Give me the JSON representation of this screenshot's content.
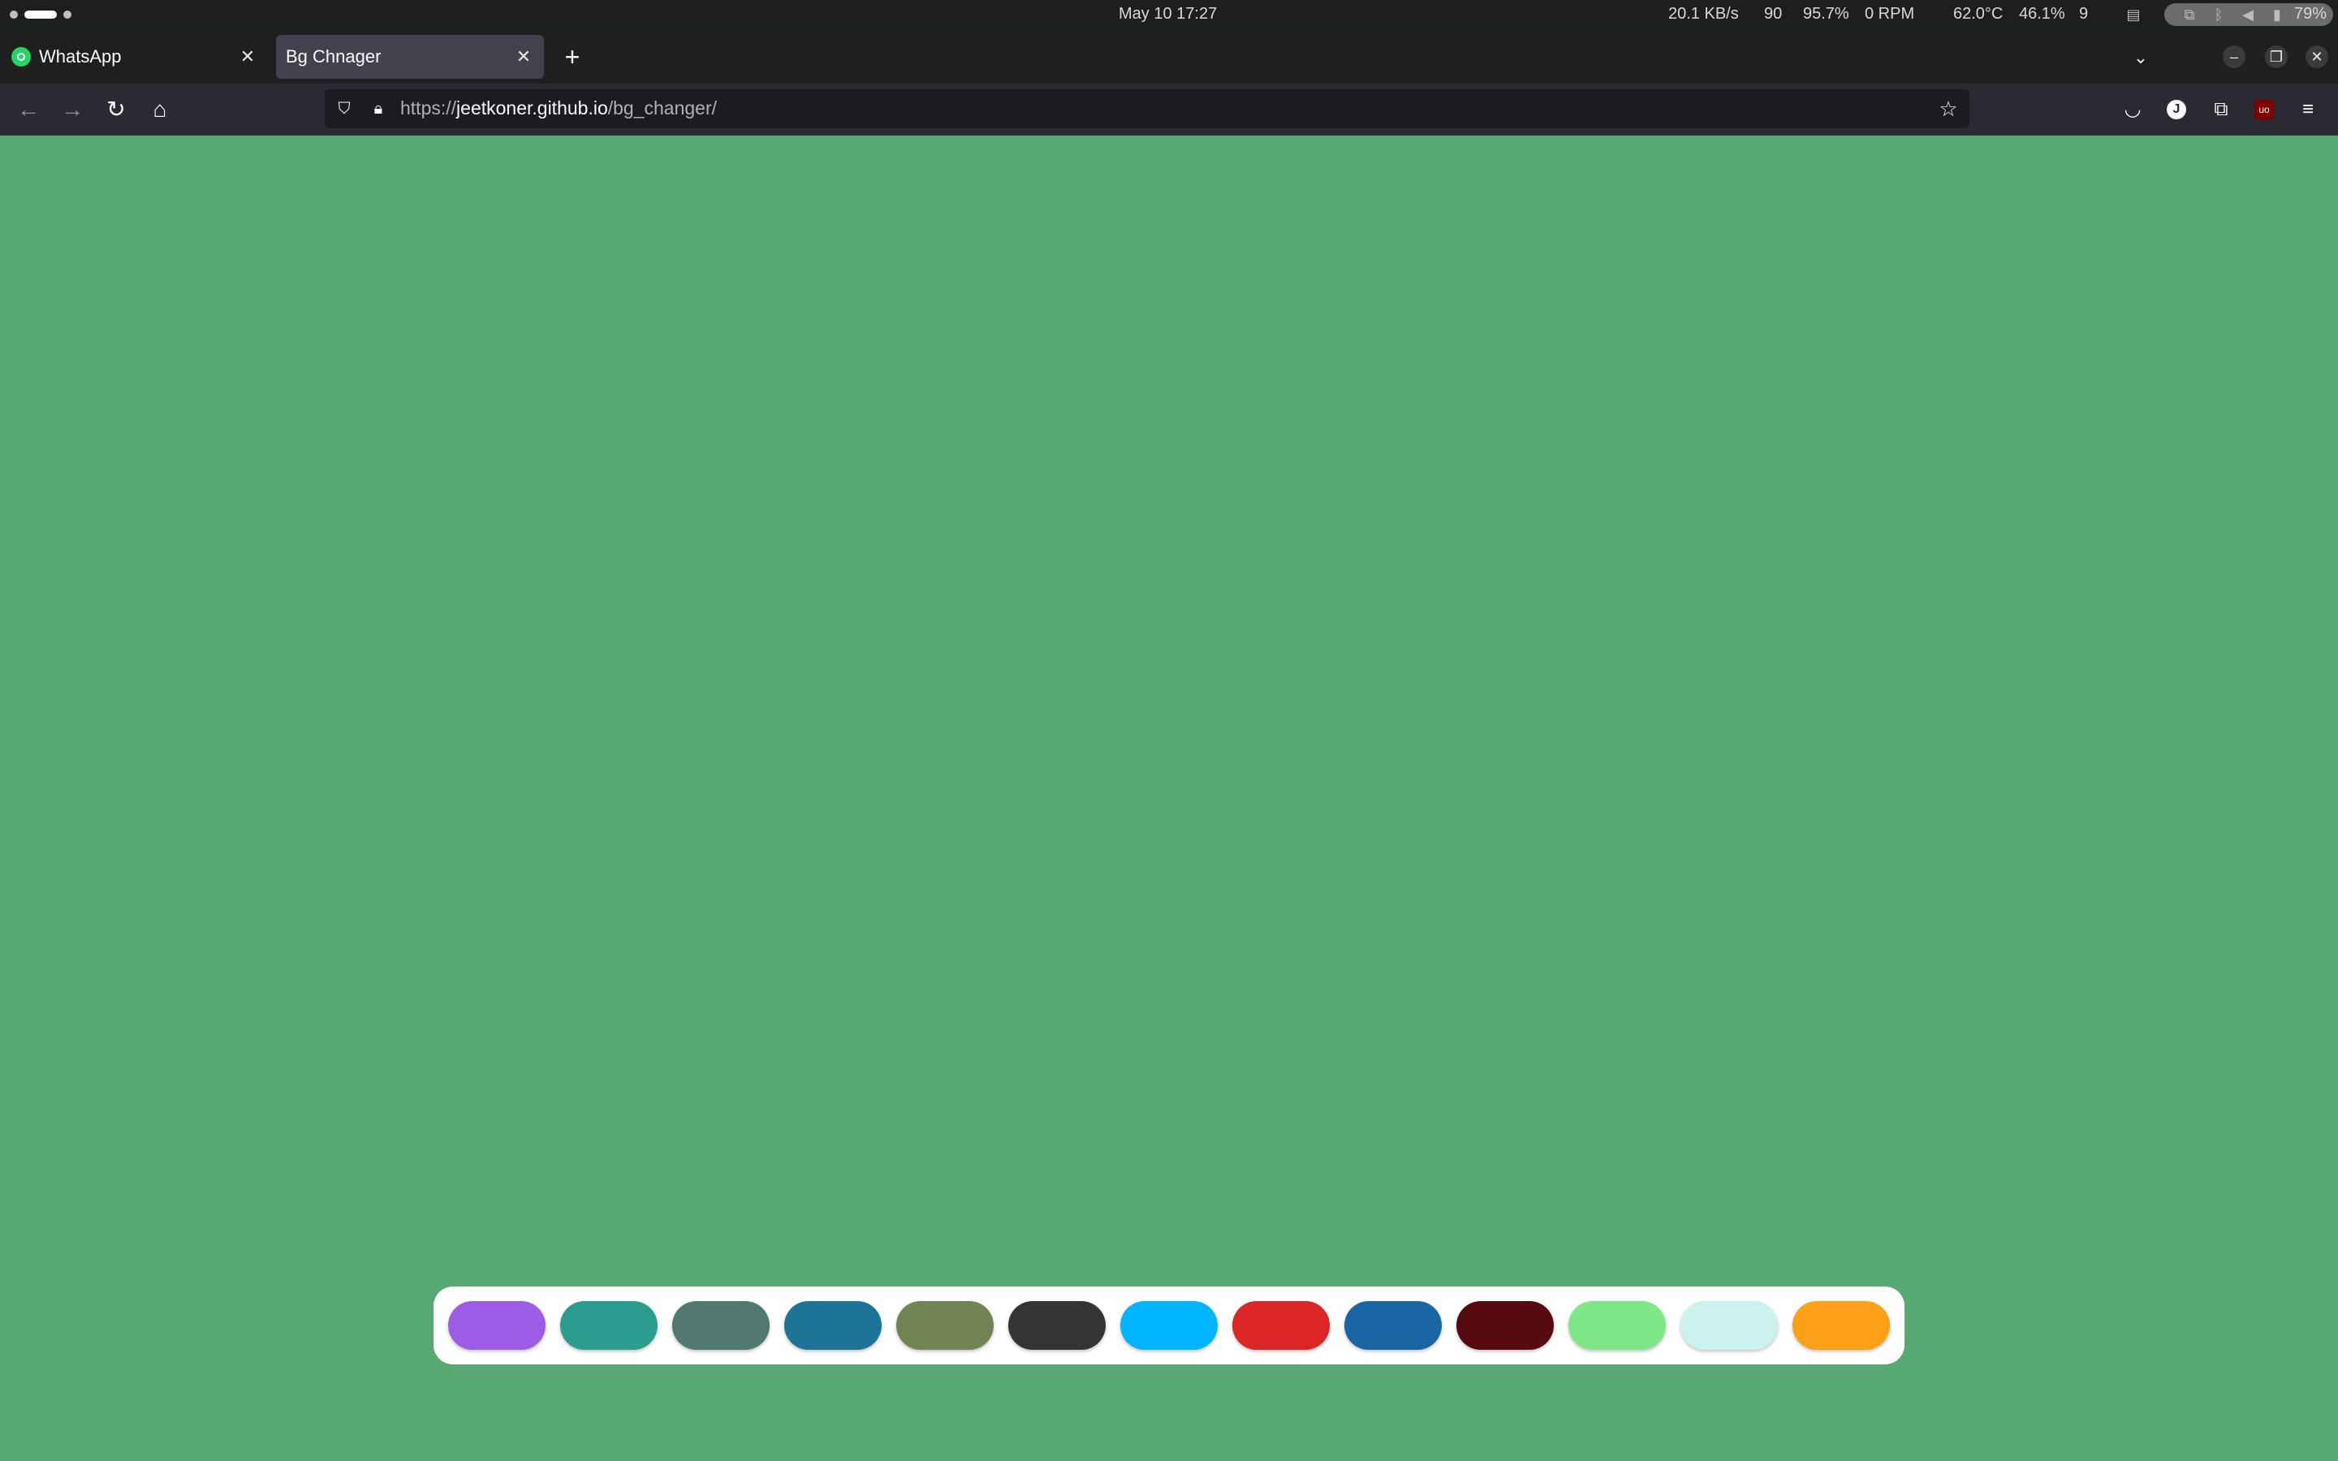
{
  "system": {
    "clock": "May 10  17:27",
    "net_speed": "20.1 KB/s",
    "stat_a": "90",
    "cpu": "95.7%",
    "fan": "0 RPM",
    "temp": "62.0°C",
    "mem": "46.1%",
    "stat_b": "9",
    "battery": "79%"
  },
  "tabs": [
    {
      "label": "WhatsApp",
      "active": false
    },
    {
      "label": "Bg Chnager",
      "active": true
    }
  ],
  "new_tab_label": "+",
  "url": {
    "scheme": "https://",
    "host": "jeetkoner.github.io",
    "path": "/bg_changer/"
  },
  "page": {
    "background": "#58a872"
  },
  "palette": [
    {
      "name": "purple",
      "color": "#9d5ce6"
    },
    {
      "name": "teal",
      "color": "#2a9d8f"
    },
    {
      "name": "slate-green",
      "color": "#52796f"
    },
    {
      "name": "steel-blue",
      "color": "#1d7497"
    },
    {
      "name": "olive",
      "color": "#708454"
    },
    {
      "name": "charcoal",
      "color": "#343434"
    },
    {
      "name": "sky-blue",
      "color": "#00b4fd"
    },
    {
      "name": "red",
      "color": "#dc2626"
    },
    {
      "name": "blue",
      "color": "#1a66a5"
    },
    {
      "name": "maroon",
      "color": "#570a10"
    },
    {
      "name": "light-green",
      "color": "#7ee787"
    },
    {
      "name": "pale-cyan",
      "color": "#ccf2ee"
    },
    {
      "name": "orange",
      "color": "#fba017"
    }
  ]
}
